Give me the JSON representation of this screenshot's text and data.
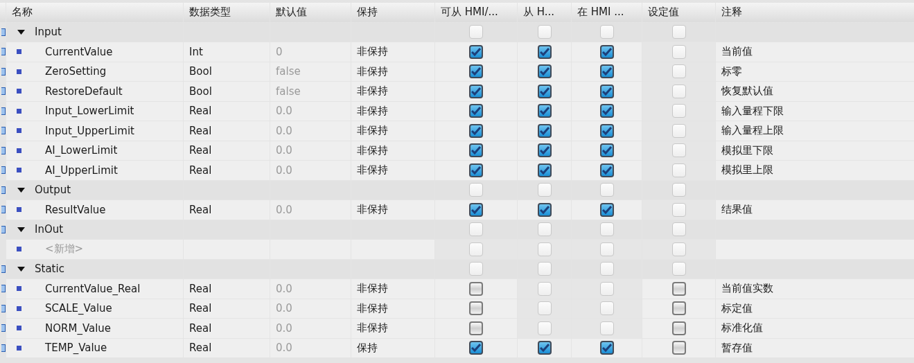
{
  "columns": [
    "名称",
    "数据类型",
    "默认值",
    "保持",
    "可从 HMI/...",
    "从 H...",
    "在 HMI ...",
    "设定值",
    "注释"
  ],
  "rows": [
    {
      "kind": "section",
      "name": "Input",
      "flags": [
        {
          "checked": false,
          "disabled": true
        },
        {
          "checked": false,
          "disabled": true
        },
        {
          "checked": false,
          "disabled": true
        },
        {
          "checked": false,
          "disabled": true
        }
      ]
    },
    {
      "kind": "item",
      "name": "CurrentValue",
      "type": "Int",
      "default": "0",
      "retain": "非保持",
      "flags": [
        {
          "checked": true,
          "disabled": false
        },
        {
          "checked": true,
          "disabled": false
        },
        {
          "checked": true,
          "disabled": false
        },
        {
          "checked": false,
          "disabled": true
        }
      ],
      "comment": "当前值"
    },
    {
      "kind": "item",
      "name": "ZeroSetting",
      "type": "Bool",
      "default": "false",
      "retain": "非保持",
      "flags": [
        {
          "checked": true,
          "disabled": false
        },
        {
          "checked": true,
          "disabled": false
        },
        {
          "checked": true,
          "disabled": false
        },
        {
          "checked": false,
          "disabled": true
        }
      ],
      "comment": "标零"
    },
    {
      "kind": "item",
      "name": "RestoreDefault",
      "type": "Bool",
      "default": "false",
      "retain": "非保持",
      "flags": [
        {
          "checked": true,
          "disabled": false
        },
        {
          "checked": true,
          "disabled": false
        },
        {
          "checked": true,
          "disabled": false
        },
        {
          "checked": false,
          "disabled": true
        }
      ],
      "comment": "恢复默认值"
    },
    {
      "kind": "item",
      "name": "Input_LowerLimit",
      "type": "Real",
      "default": "0.0",
      "retain": "非保持",
      "flags": [
        {
          "checked": true,
          "disabled": false
        },
        {
          "checked": true,
          "disabled": false
        },
        {
          "checked": true,
          "disabled": false
        },
        {
          "checked": false,
          "disabled": true
        }
      ],
      "comment": "输入量程下限"
    },
    {
      "kind": "item",
      "name": "Input_UpperLimit",
      "type": "Real",
      "default": "0.0",
      "retain": "非保持",
      "flags": [
        {
          "checked": true,
          "disabled": false
        },
        {
          "checked": true,
          "disabled": false
        },
        {
          "checked": true,
          "disabled": false
        },
        {
          "checked": false,
          "disabled": true
        }
      ],
      "comment": "输入量程上限"
    },
    {
      "kind": "item",
      "name": "AI_LowerLimit",
      "type": "Real",
      "default": "0.0",
      "retain": "非保持",
      "flags": [
        {
          "checked": true,
          "disabled": false
        },
        {
          "checked": true,
          "disabled": false
        },
        {
          "checked": true,
          "disabled": false
        },
        {
          "checked": false,
          "disabled": true
        }
      ],
      "comment": "模拟里下限"
    },
    {
      "kind": "item",
      "name": "AI_UpperLimit",
      "type": "Real",
      "default": "0.0",
      "retain": "非保持",
      "flags": [
        {
          "checked": true,
          "disabled": false
        },
        {
          "checked": true,
          "disabled": false
        },
        {
          "checked": true,
          "disabled": false
        },
        {
          "checked": false,
          "disabled": true
        }
      ],
      "comment": "模拟里上限"
    },
    {
      "kind": "section",
      "name": "Output",
      "flags": [
        {
          "checked": false,
          "disabled": true
        },
        {
          "checked": false,
          "disabled": true
        },
        {
          "checked": false,
          "disabled": true
        },
        {
          "checked": false,
          "disabled": true
        }
      ]
    },
    {
      "kind": "item",
      "name": "ResultValue",
      "type": "Real",
      "default": "0.0",
      "retain": "非保持",
      "flags": [
        {
          "checked": true,
          "disabled": false
        },
        {
          "checked": true,
          "disabled": false
        },
        {
          "checked": true,
          "disabled": false
        },
        {
          "checked": false,
          "disabled": true
        }
      ],
      "comment": "结果值"
    },
    {
      "kind": "section",
      "name": "InOut",
      "flags": [
        {
          "checked": false,
          "disabled": true
        },
        {
          "checked": false,
          "disabled": true
        },
        {
          "checked": false,
          "disabled": true
        },
        {
          "checked": false,
          "disabled": true
        }
      ]
    },
    {
      "kind": "add",
      "name": "<新增>",
      "flags": [
        {
          "checked": false,
          "disabled": true
        },
        {
          "checked": false,
          "disabled": true
        },
        {
          "checked": false,
          "disabled": true
        },
        {
          "checked": false,
          "disabled": true
        }
      ]
    },
    {
      "kind": "section",
      "name": "Static",
      "flags": [
        {
          "checked": false,
          "disabled": true
        },
        {
          "checked": false,
          "disabled": true
        },
        {
          "checked": false,
          "disabled": true
        },
        {
          "checked": false,
          "disabled": true
        }
      ]
    },
    {
      "kind": "item",
      "name": "CurrentValue_Real",
      "type": "Real",
      "default": "0.0",
      "retain": "非保持",
      "flags": [
        {
          "checked": false,
          "disabled": false
        },
        {
          "checked": false,
          "disabled": true
        },
        {
          "checked": false,
          "disabled": true
        },
        {
          "checked": false,
          "disabled": false
        }
      ],
      "comment": "当前值实数"
    },
    {
      "kind": "item",
      "name": "SCALE_Value",
      "type": "Real",
      "default": "0.0",
      "retain": "非保持",
      "flags": [
        {
          "checked": false,
          "disabled": false
        },
        {
          "checked": false,
          "disabled": true
        },
        {
          "checked": false,
          "disabled": true
        },
        {
          "checked": false,
          "disabled": false
        }
      ],
      "comment": "标定值"
    },
    {
      "kind": "item",
      "name": "NORM_Value",
      "type": "Real",
      "default": "0.0",
      "retain": "非保持",
      "flags": [
        {
          "checked": false,
          "disabled": false
        },
        {
          "checked": false,
          "disabled": true
        },
        {
          "checked": false,
          "disabled": true
        },
        {
          "checked": false,
          "disabled": false
        }
      ],
      "comment": "标准化值"
    },
    {
      "kind": "item",
      "name": "TEMP_Value",
      "type": "Real",
      "default": "0.0",
      "retain": "保持",
      "flags": [
        {
          "checked": true,
          "disabled": false
        },
        {
          "checked": true,
          "disabled": false
        },
        {
          "checked": true,
          "disabled": false
        },
        {
          "checked": false,
          "disabled": false
        }
      ],
      "comment": "暂存值"
    }
  ]
}
